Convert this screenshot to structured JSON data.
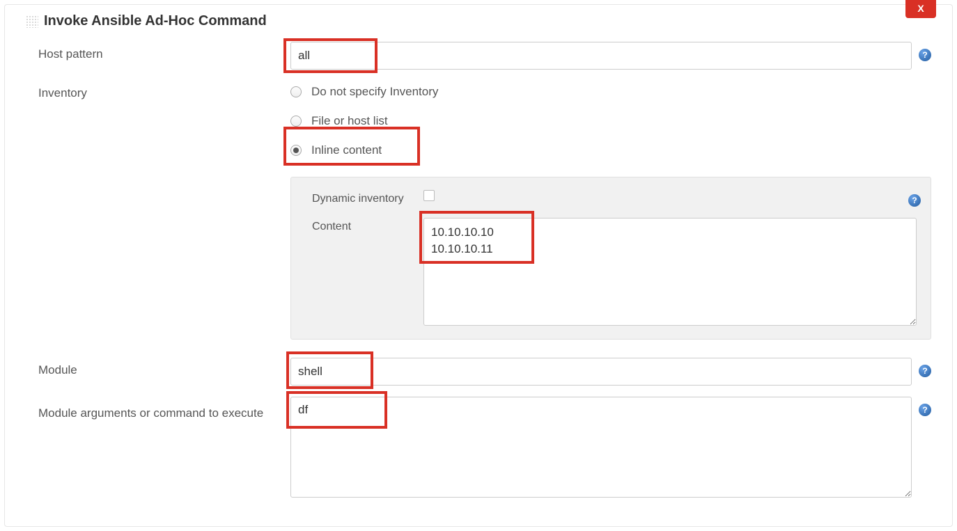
{
  "close_label": "X",
  "panel_title": "Invoke Ansible Ad-Hoc Command",
  "host_pattern": {
    "label": "Host pattern",
    "value": "all"
  },
  "inventory": {
    "label": "Inventory",
    "options": {
      "none": "Do not specify Inventory",
      "file": "File or host list",
      "inline": "Inline content"
    },
    "selected": "inline",
    "dynamic_label": "Dynamic inventory",
    "dynamic_checked": false,
    "content_label": "Content",
    "content_value": "10.10.10.10\n10.10.10.11"
  },
  "module": {
    "label": "Module",
    "value": "shell"
  },
  "module_args": {
    "label": "Module arguments or command to execute",
    "value": "df"
  },
  "help_glyph": "?"
}
